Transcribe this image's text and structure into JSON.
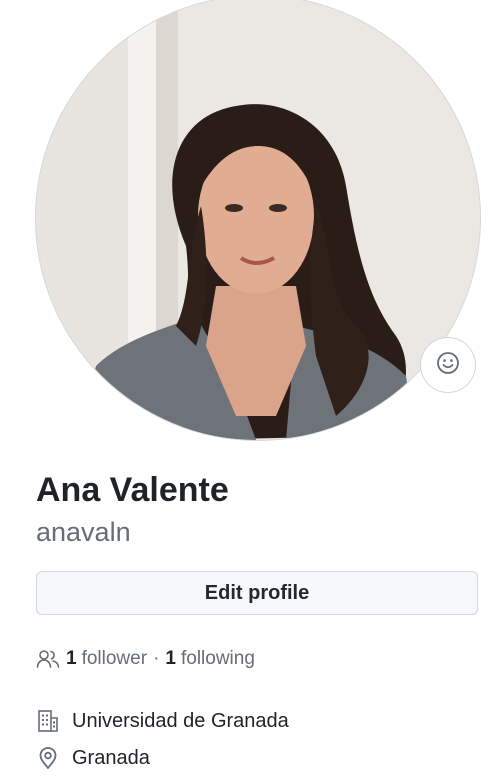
{
  "profile": {
    "full_name": "Ana Valente",
    "login": "anavaln",
    "edit_label": "Edit profile",
    "followers_count": "1",
    "followers_label": "follower",
    "separator": "·",
    "following_count": "1",
    "following_label": "following",
    "organization": "Universidad de Granada",
    "location": "Granada"
  },
  "icons": {
    "status": "smiley-icon",
    "followers": "people-icon",
    "organization": "building-icon",
    "location": "location-pin-icon"
  },
  "colors": {
    "text_primary": "#1f2328",
    "text_muted": "#656d76",
    "button_bg": "#f6f8fa",
    "border": "#d0d7de"
  }
}
